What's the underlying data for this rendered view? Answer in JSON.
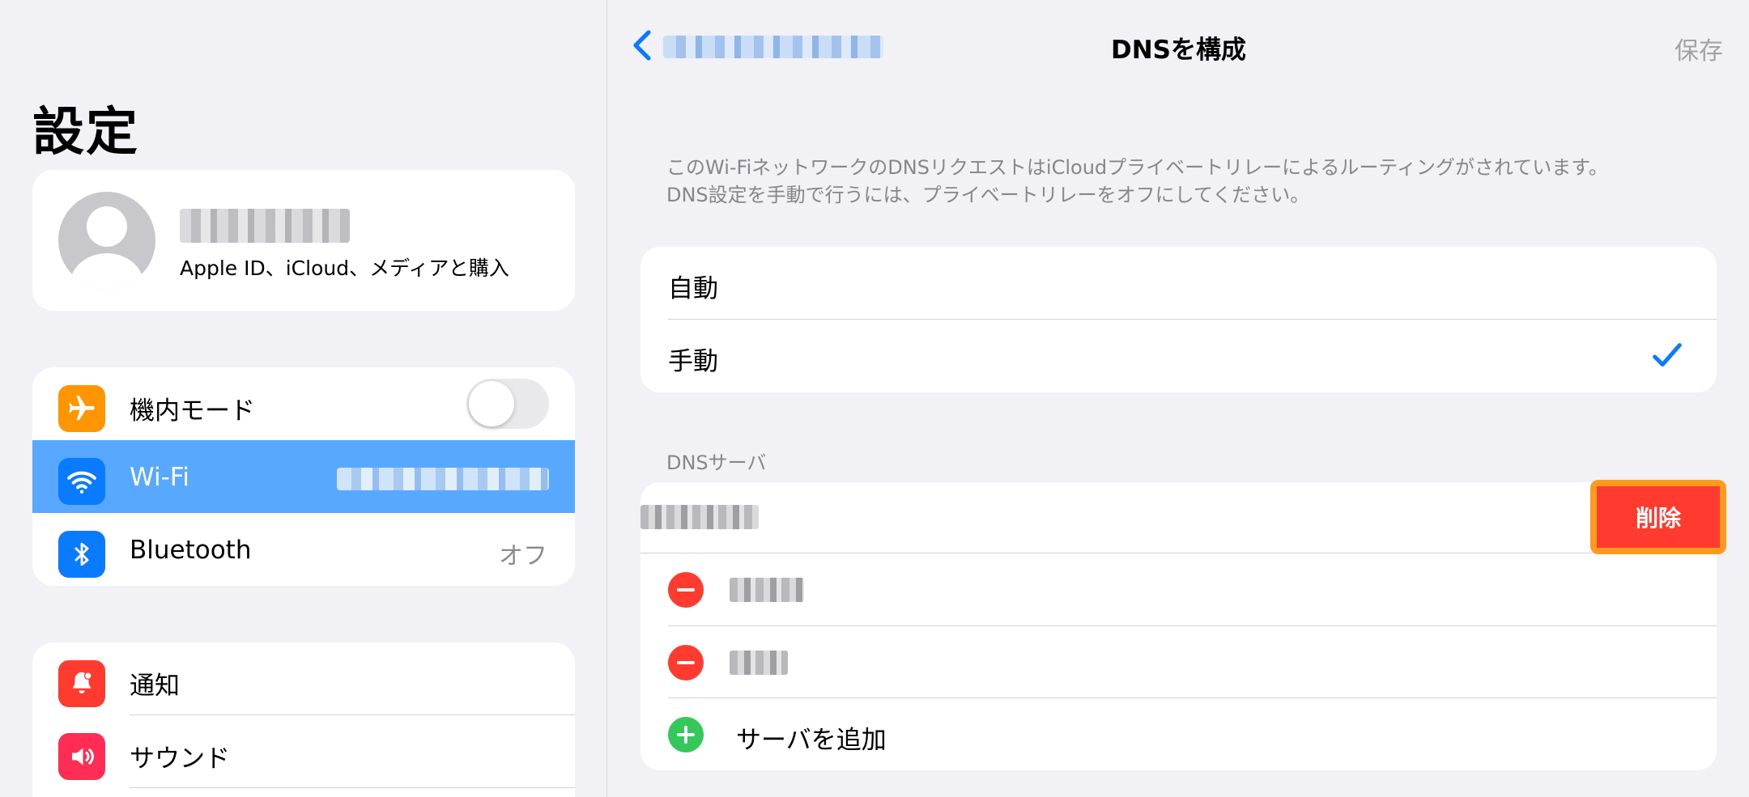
{
  "sidebar": {
    "title": "設定",
    "profile": {
      "name": "",
      "subtitle": "Apple ID、iCloud、メディアと購入"
    },
    "network_group": [
      {
        "label": "機内モード",
        "icon": "airplane-icon",
        "color": "#ff9500",
        "toggle": false
      },
      {
        "label": "Wi-Fi",
        "icon": "wifi-icon",
        "color": "#0a7aff",
        "selected": true
      },
      {
        "label": "Bluetooth",
        "icon": "bluetooth-icon",
        "color": "#0a7aff",
        "value": "オフ"
      }
    ],
    "general_group": [
      {
        "label": "通知",
        "icon": "bell-icon",
        "color": "#ff3b30"
      },
      {
        "label": "サウンド",
        "icon": "speaker-icon",
        "color": "#ff2d55"
      }
    ]
  },
  "detail": {
    "nav": {
      "back_label": "",
      "title": "DNSを構成",
      "save_label": "保存"
    },
    "note_line1": "このWi-FiネットワークのDNSリクエストはiCloudプライベートリレーによるルーティングがされています。",
    "note_line2": "DNS設定を手動で行うには、プライベートリレーをオフにしてください。",
    "modes": [
      {
        "label": "自動",
        "checked": false
      },
      {
        "label": "手動",
        "checked": true
      }
    ],
    "servers_header": "DNSサーバ",
    "add_server_label": "サーバを追加",
    "delete_label": "削除"
  },
  "colors": {
    "accent": "#0a7aff",
    "destructive": "#ff3b30",
    "add": "#34c759",
    "highlight": "#ff9a1e",
    "selected_row": "#58a8ff"
  }
}
